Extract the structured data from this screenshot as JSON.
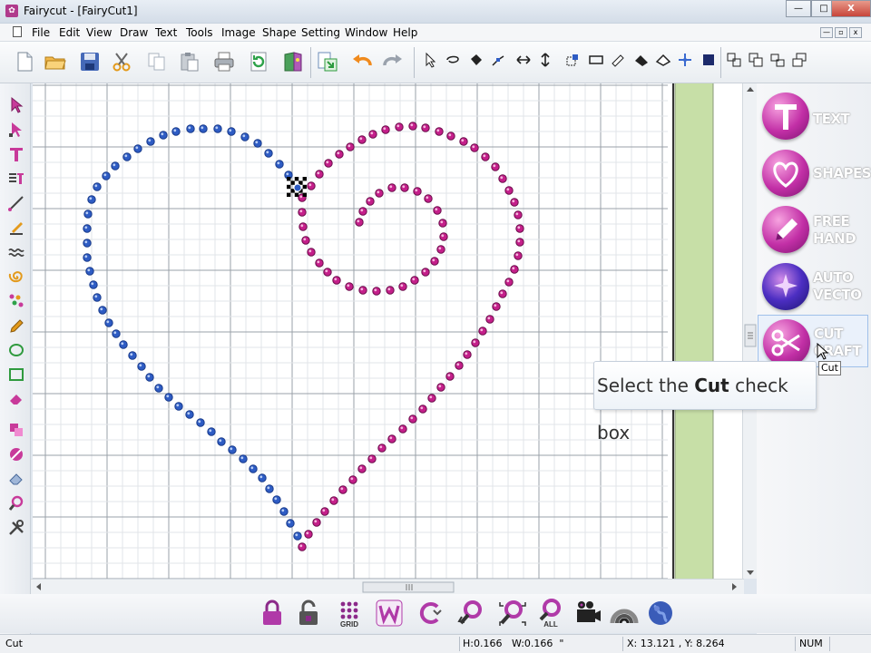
{
  "window": {
    "title": "Fairycut - [FairyCut1]",
    "minimize": "—",
    "maximize": "□",
    "close": "X"
  },
  "menu": {
    "items": [
      "File",
      "Edit",
      "View",
      "Draw",
      "Text",
      "Tools",
      "Image",
      "Shape",
      "Setting",
      "Window",
      "Help"
    ]
  },
  "toolbar": {
    "icons": [
      "new-document-icon",
      "open-folder-icon",
      "save-icon",
      "cut-scissors-icon",
      "copy-icon",
      "paste-icon",
      "print-icon",
      "refresh-icon",
      "library-book-icon",
      "import-icon",
      "undo-icon",
      "redo-icon",
      "select-arrow-icon",
      "lasso-icon",
      "fill-icon",
      "node-icon",
      "flip-horizontal-icon",
      "flip-vertical-icon",
      "group-icon",
      "rectangle-select-icon",
      "eraser-edit-icon",
      "weld-icon",
      "contour-icon",
      "move-icon",
      "solid-square-icon",
      "align-icon",
      "combine-icon",
      "break-apart-icon",
      "arrange-icon"
    ]
  },
  "left_tools": {
    "icons": [
      "select-arrow-icon",
      "node-edit-icon",
      "text-icon",
      "text-on-path-icon",
      "line-icon",
      "pen-icon",
      "wave-icon",
      "spiral-icon",
      "rhinestone-pattern-icon",
      "pencil-icon",
      "ellipse-icon",
      "rectangle-icon",
      "eraser-icon",
      "shape-convert-icon",
      "brush-icon",
      "erase-tool-icon",
      "zoom-icon",
      "tools-icon"
    ]
  },
  "right_panel": {
    "buttons": [
      {
        "label_line1": "TEXT",
        "label_line2": "",
        "icon": "text-t-icon"
      },
      {
        "label_line1": "SHAPES",
        "label_line2": "",
        "icon": "heart-icon"
      },
      {
        "label_line1": "FREE",
        "label_line2": "HAND",
        "icon": "pencil-icon"
      },
      {
        "label_line1": "AUTO",
        "label_line2": "VECTO",
        "icon": "sparkle-icon"
      },
      {
        "label_line1": "CUT",
        "label_line2": "CRAFT",
        "icon": "scissors-icon"
      }
    ]
  },
  "tooltip": {
    "prefix": "Select the ",
    "bold": "Cut",
    "suffix": " check box"
  },
  "mini_tooltip": "Cut",
  "bottom_toolbar": {
    "icons": [
      "lock-icon",
      "unlock-icon",
      "grid-icon",
      "w-logo-icon",
      "c-rotate-icon",
      "zoom-back-icon",
      "zoom-fit-icon",
      "zoom-all-icon",
      "camera-icon",
      "rainbow-arc-icon",
      "globe-icon"
    ],
    "grid_label": "GRID",
    "all_label": "ALL"
  },
  "status": {
    "left": "Cut",
    "dimensions": "H:0.166   W:0.166  \"",
    "coords": "X: 13.121 , Y: 8.264",
    "num": "NUM"
  },
  "colors": {
    "blue_rhinestone": "#2e5cc4",
    "pink_rhinestone": "#c41f8a",
    "panel_magenta": "#c22fa6",
    "green_strip": "#c7dfa7"
  }
}
